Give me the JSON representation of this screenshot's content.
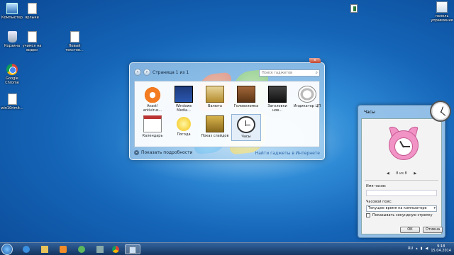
{
  "desktop": {
    "icons": [
      {
        "label": "Компьютер"
      },
      {
        "label": "ярлыки"
      },
      {
        "label": "Корзина"
      },
      {
        "label": "учимся на видео"
      },
      {
        "label": "Новый текстов..."
      },
      {
        "label": "Google Chrome"
      },
      {
        "label": "win10rimit..."
      },
      {
        "label": "панель управления"
      }
    ]
  },
  "gallery": {
    "page": "Страница 1 из 1",
    "search_placeholder": "Поиск гаджетов",
    "close": "x",
    "tiles": [
      {
        "label": "Avast! antivirus...",
        "icon": "avast-icon"
      },
      {
        "label": "Windows Media...",
        "icon": "media-center-icon"
      },
      {
        "label": "Валюта",
        "icon": "currency-icon"
      },
      {
        "label": "Головоломка",
        "icon": "puzzle-icon"
      },
      {
        "label": "Заголовки нов...",
        "icon": "feed-headlines-icon"
      },
      {
        "label": "Индикатор ЦП",
        "icon": "cpu-meter-icon"
      },
      {
        "label": "Календарь",
        "icon": "calendar-icon"
      },
      {
        "label": "Погода",
        "icon": "weather-icon"
      },
      {
        "label": "Показ слайдов",
        "icon": "slideshow-icon"
      },
      {
        "label": "Часы",
        "icon": "clock-icon"
      }
    ],
    "details": "Показать подробности",
    "online": "Найти гаджеты в Интернете"
  },
  "clock_dialog": {
    "title": "Часы",
    "pager": "8 из 8",
    "name_label": "Имя часов:",
    "name_value": "",
    "tz_label": "Часовой пояс:",
    "tz_value": "Текущее время на компьютере",
    "seconds_label": "Показывать секундную стрелку",
    "ok": "ОК",
    "cancel": "Отмена"
  },
  "taskbar": {
    "lang": "RU",
    "time": "9:18",
    "date": "15.04.2014"
  }
}
